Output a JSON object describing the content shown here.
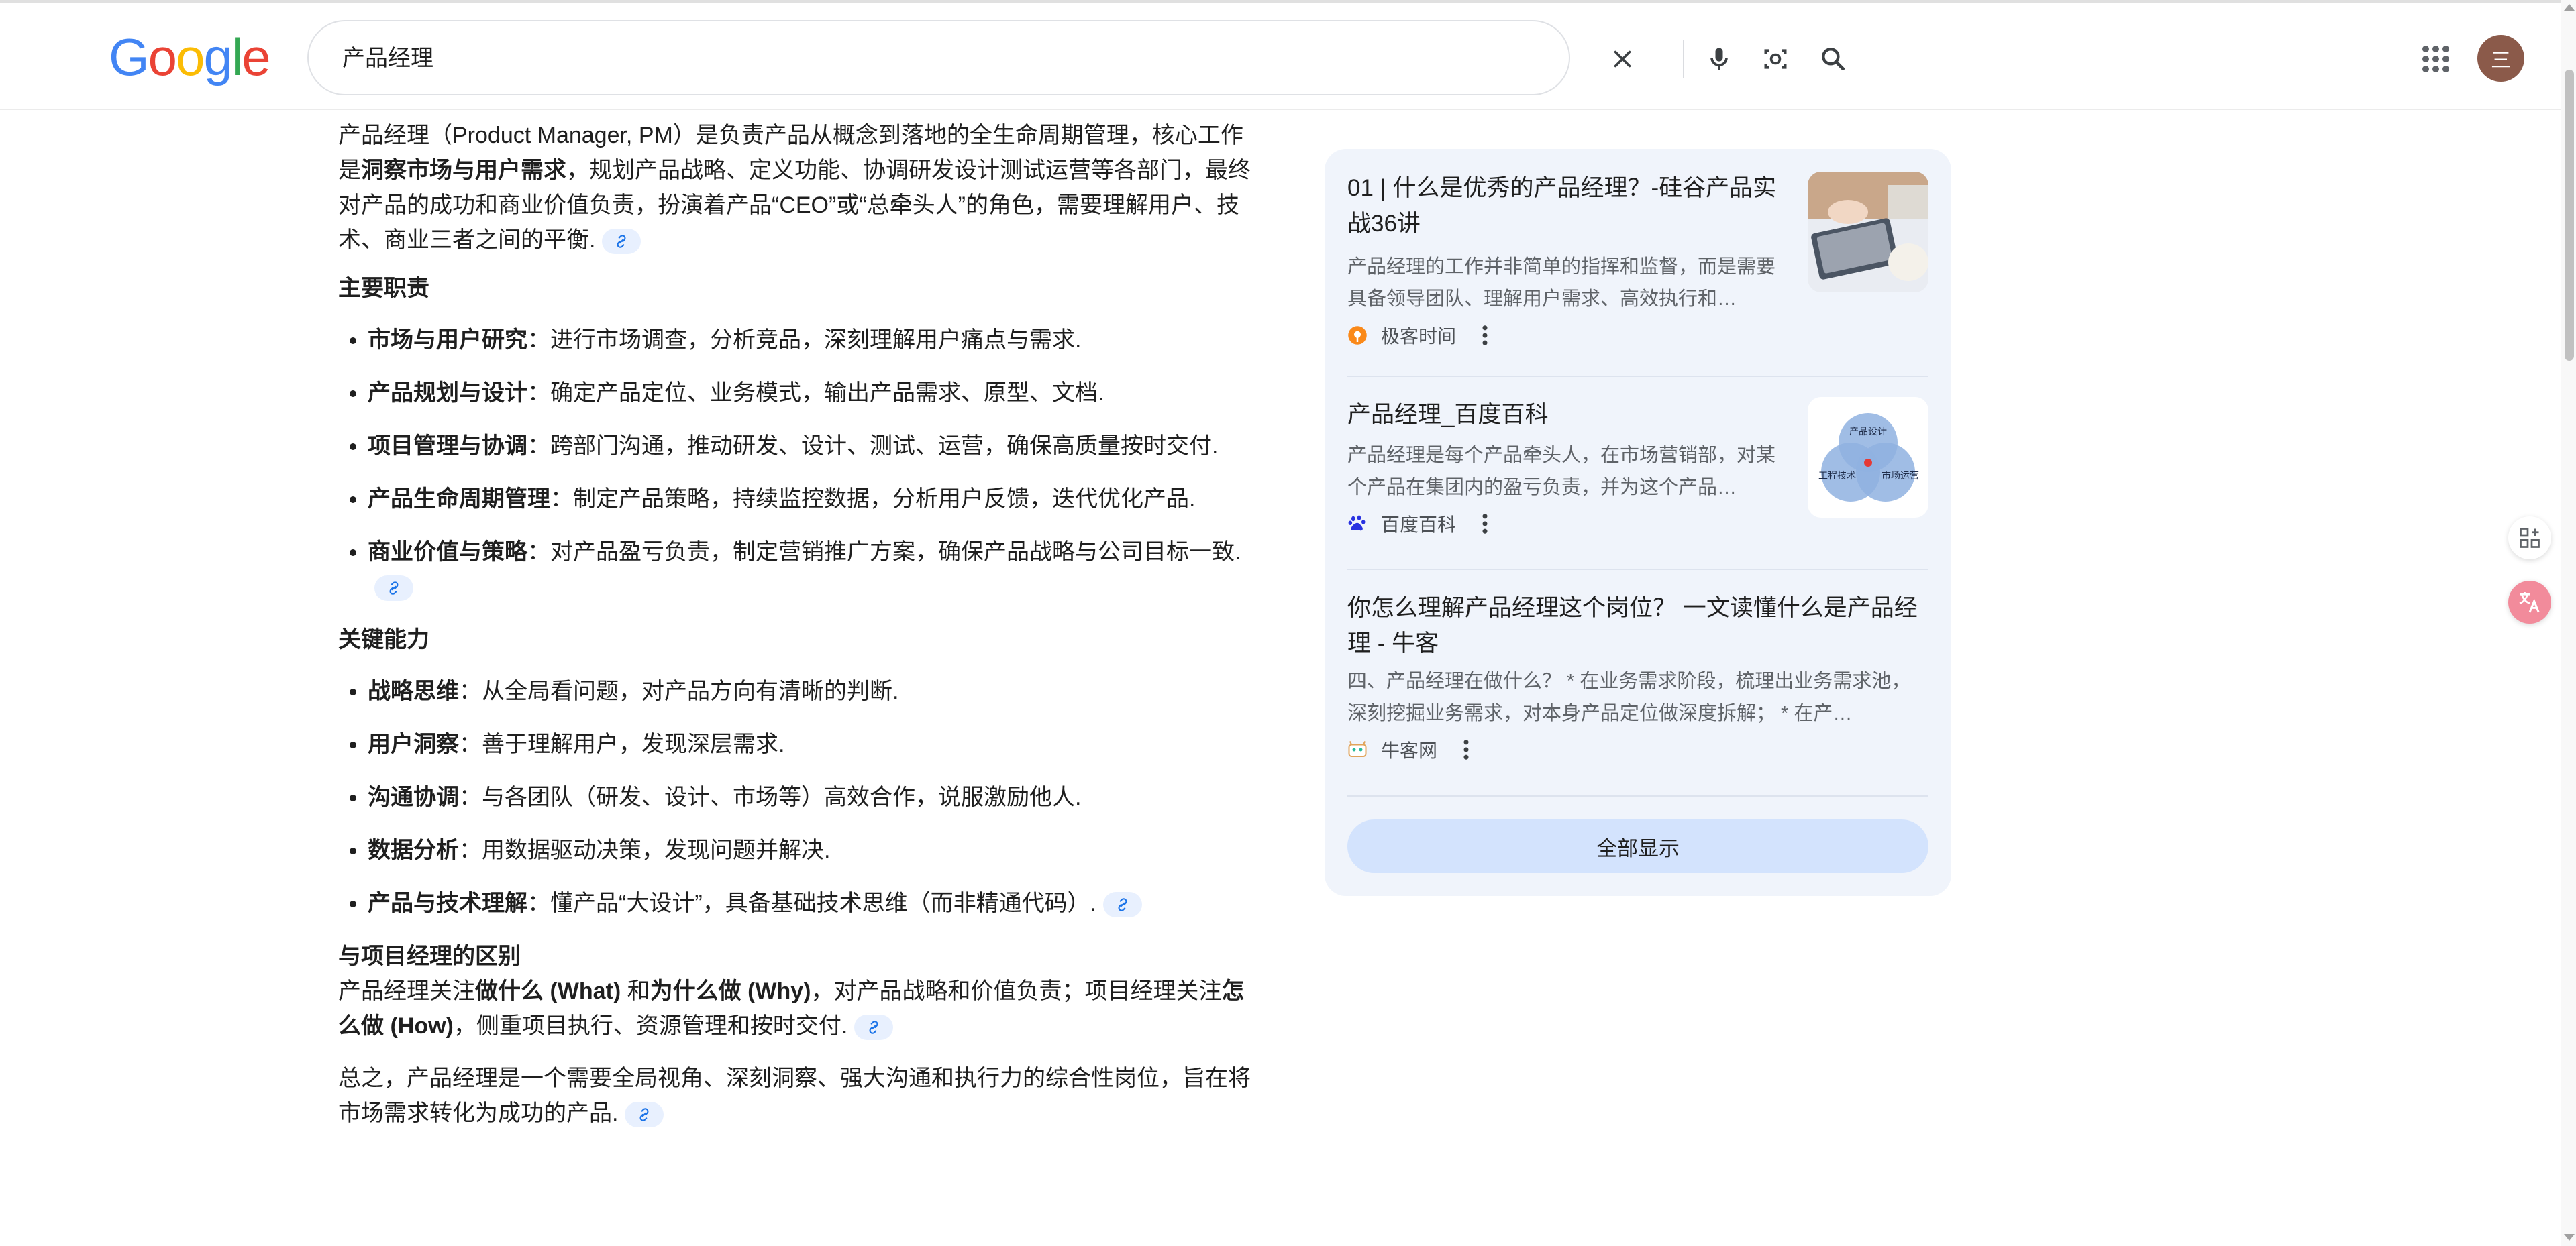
{
  "header": {
    "logo": {
      "letters": [
        "G",
        "o",
        "o",
        "g",
        "l",
        "e"
      ],
      "colors": [
        "#4285F4",
        "#EA4335",
        "#FBBC05",
        "#4285F4",
        "#34A853",
        "#EA4335"
      ]
    },
    "search": {
      "value": "产品经理"
    },
    "avatar_letter": "三"
  },
  "answer": {
    "intro": {
      "t1": "产品经理（Product Manager, PM）是负责产品从概念到落地的全生命周期管理，核心工作是",
      "b1": "洞察市场与用户需求",
      "t2": "，规划产品战略、定义功能、协调研发设计测试运营等各部门，最终对产品的成功和商业价值负责，扮演着产品“CEO”或“总牵头人”的角色，需要理解用户、技术、商业三者之间的平衡."
    },
    "duties": {
      "title": "主要职责",
      "items": [
        {
          "bold": "市场与用户研究",
          "text": "：进行市场调查，分析竞品，深刻理解用户痛点与需求."
        },
        {
          "bold": "产品规划与设计",
          "text": "：确定产品定位、业务模式，输出产品需求、原型、文档."
        },
        {
          "bold": "项目管理与协调",
          "text": "：跨部门沟通，推动研发、设计、测试、运营，确保高质量按时交付."
        },
        {
          "bold": "产品生命周期管理",
          "text": "：制定产品策略，持续监控数据，分析用户反馈，迭代优化产品."
        },
        {
          "bold": "商业价值与策略",
          "text": "：对产品盈亏负责，制定营销推广方案，确保产品战略与公司目标一致."
        }
      ]
    },
    "abilities": {
      "title": "关键能力",
      "items": [
        {
          "bold": "战略思维",
          "text": "：从全局看问题，对产品方向有清晰的判断."
        },
        {
          "bold": "用户洞察",
          "text": "：善于理解用户，发现深层需求."
        },
        {
          "bold": "沟通协调",
          "text": "：与各团队（研发、设计、市场等）高效合作，说服激励他人."
        },
        {
          "bold": "数据分析",
          "text": "：用数据驱动决策，发现问题并解决."
        },
        {
          "bold": "产品与技术理解",
          "text": "：懂产品“大设计”，具备基础技术思维（而非精通代码）."
        }
      ]
    },
    "diff": {
      "title": "与项目经理的区别",
      "t1": "产品经理关注",
      "b1": "做什么 (What)",
      "t2": " 和",
      "b2": "为什么做 (Why)",
      "t3": "，对产品战略和价值负责；项目经理关注",
      "b3": "怎么做 (How)",
      "t4": "，侧重项目执行、资源管理和按时交付."
    },
    "conclusion": "总之，产品经理是一个需要全局视角、深刻洞察、强大沟通和执行力的综合性岗位，旨在将市场需求转化为成功的产品."
  },
  "sources": {
    "cards": [
      {
        "title": "01 | 什么是优秀的产品经理？-硅谷产品实战36讲",
        "snippet": "产品经理的工作并非简单的指挥和监督，而是需要具备领导团队、理解用户需求、高效执行和…",
        "site": "极客时间"
      },
      {
        "title": "产品经理_百度百科",
        "snippet": "产品经理是每个产品牵头人，在市场营销部，对某个产品在集团内的盈亏负责，并为这个产品…",
        "site": "百度百科",
        "thumb_labels": [
          "产品设计",
          "工程技术",
          "市场运营"
        ]
      },
      {
        "title": "你怎么理解产品经理这个岗位？ 一文读懂什么是产品经理 - 牛客",
        "snippet": "四、产品经理在做什么？ * 在业务需求阶段，梳理出业务需求池，深刻挖掘业务需求，对本身产品定位做深度拆解； * 在产…",
        "site": "牛客网"
      }
    ],
    "show_all": "全部显示"
  }
}
